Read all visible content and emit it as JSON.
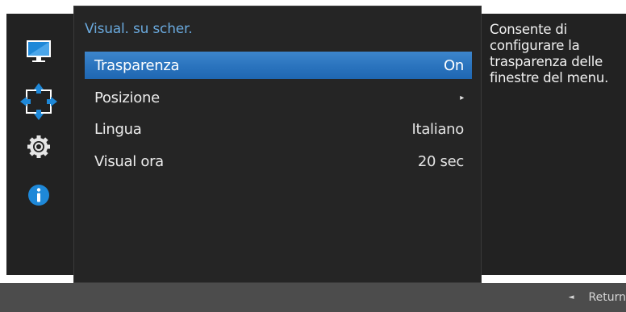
{
  "menu": {
    "title": "Visual. su scher.",
    "items": [
      {
        "label": "Trasparenza",
        "value": "On"
      },
      {
        "label": "Posizione",
        "value": "▸"
      },
      {
        "label": "Lingua",
        "value": "Italiano"
      },
      {
        "label": "Visual ora",
        "value": "20 sec"
      }
    ],
    "selected_index": 0
  },
  "sidebar": {
    "icons": [
      "monitor-icon",
      "move-arrows-icon",
      "gear-icon",
      "info-icon"
    ],
    "active_icon": "move-arrows-icon"
  },
  "help": {
    "text": "Consente di configurare la trasparenza delle finestre del menu."
  },
  "footer": {
    "return_arrow": "◄",
    "return_label": "Return"
  },
  "colors": {
    "accent": "#2a73bd",
    "title": "#6aa9dd",
    "icon_blue": "#1e88d8"
  }
}
